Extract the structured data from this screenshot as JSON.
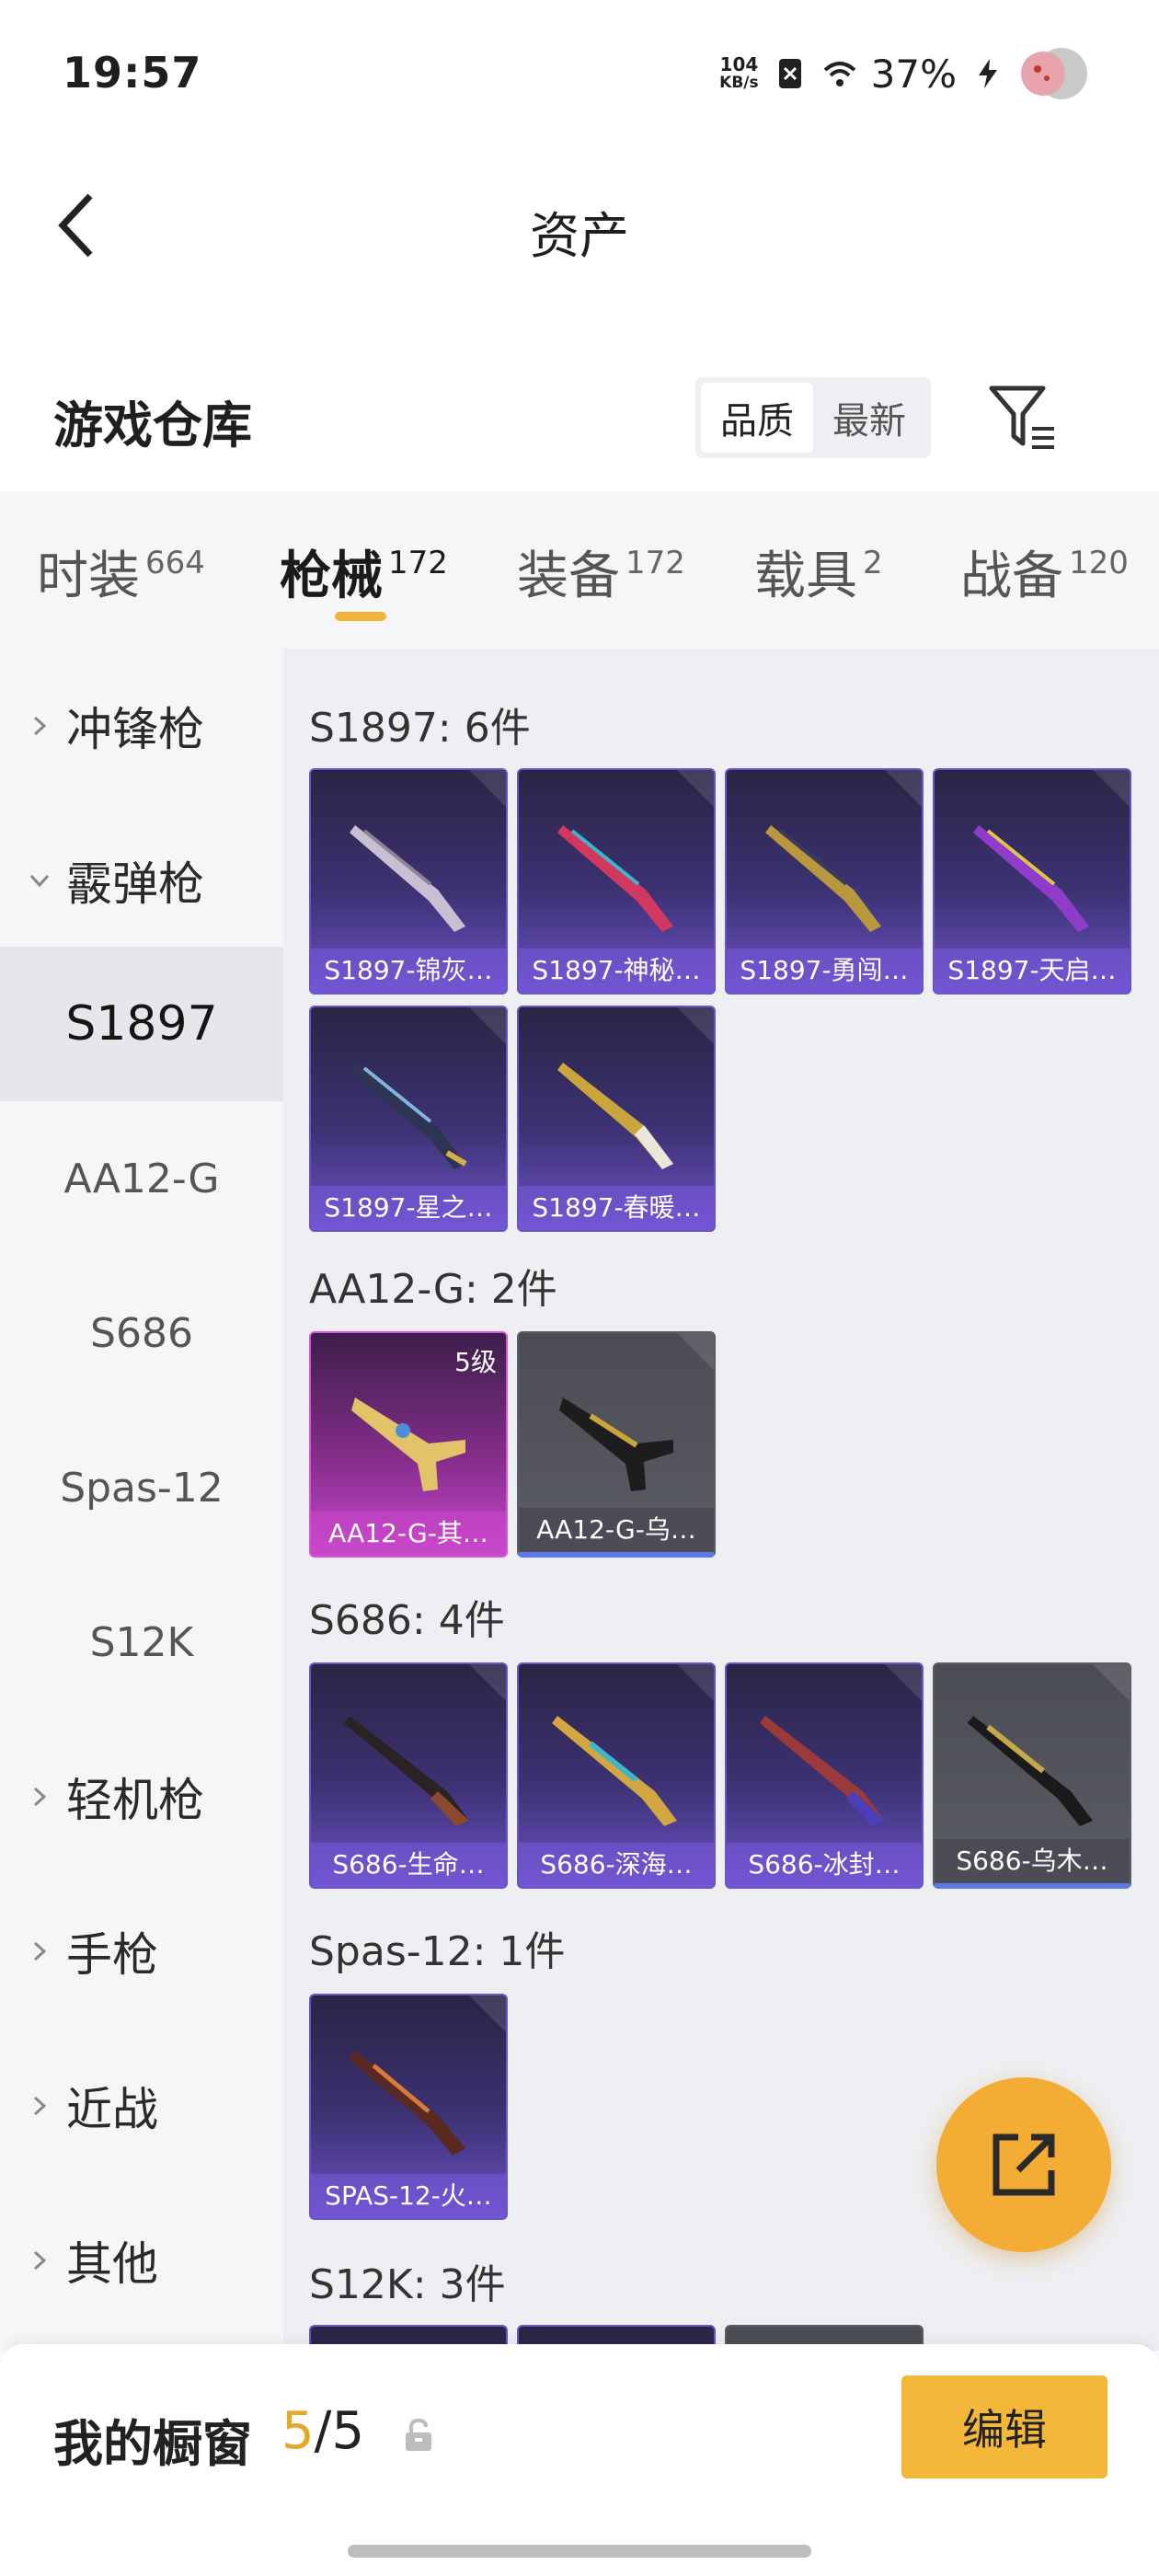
{
  "status_bar": {
    "time": "19:57",
    "net_speed_value": "104",
    "net_speed_unit": "KB/s",
    "battery": "37%"
  },
  "header": {
    "title": "资产"
  },
  "section": {
    "title": "游戏仓库",
    "sort_options": [
      "品质",
      "最新"
    ],
    "sort_selected": "品质"
  },
  "tabs": [
    {
      "label": "时装",
      "count": "664"
    },
    {
      "label": "枪械",
      "count": "172"
    },
    {
      "label": "装备",
      "count": "172"
    },
    {
      "label": "载具",
      "count": "2"
    },
    {
      "label": "战备",
      "count": "120"
    }
  ],
  "sidenav": {
    "smg": "冲锋枪",
    "shotgun": "霰弹枪",
    "subs": [
      "S1897",
      "AA12-G",
      "S686",
      "Spas-12",
      "S12K"
    ],
    "lmg": "轻机枪",
    "pistol": "手枪",
    "melee": "近战",
    "other": "其他"
  },
  "groups": {
    "s1897": {
      "title": "S1897: 6件",
      "items": [
        "S1897-锦灰…",
        "S1897-神秘…",
        "S1897-勇闯…",
        "S1897-天启…",
        "S1897-星之…",
        "S1897-春暖…"
      ]
    },
    "aa12": {
      "title": "AA12-G: 2件",
      "items": [
        "AA12-G-其…",
        "AA12-G-乌…"
      ],
      "level_badge": "5级"
    },
    "s686": {
      "title": "S686: 4件",
      "items": [
        "S686-生命…",
        "S686-深海…",
        "S686-冰封…",
        "S686-乌木…"
      ]
    },
    "spas12": {
      "title": "Spas-12: 1件",
      "items": [
        "SPAS-12-火…"
      ]
    },
    "s12k": {
      "title": "S12K: 3件"
    }
  },
  "bottom_bar": {
    "label": "我的橱窗",
    "current": "5",
    "total": "/5",
    "edit_label": "编辑"
  },
  "colors": {
    "accent": "#f3b83a",
    "tab_underline": "#f2b23c",
    "card_purple": "#3d3274",
    "card_grey": "#5a5b63",
    "card_pink": "#c94ad0"
  }
}
